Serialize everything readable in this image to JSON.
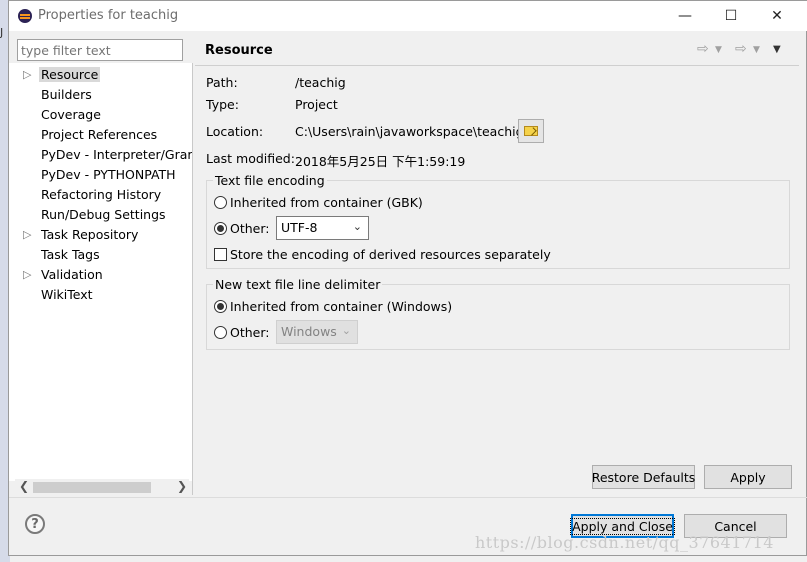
{
  "background": {
    "left_char": "J"
  },
  "window": {
    "title": "Properties for teachig",
    "controls": {
      "minimize": "—",
      "maximize": "☐",
      "close": "✕"
    }
  },
  "filter": {
    "placeholder": "type filter text"
  },
  "tree": {
    "items": [
      {
        "label": "Resource",
        "expandable": true,
        "selected": true
      },
      {
        "label": "Builders",
        "expandable": false
      },
      {
        "label": "Coverage",
        "expandable": false
      },
      {
        "label": "Project References",
        "expandable": false
      },
      {
        "label": "PyDev - Interpreter/Grar",
        "expandable": false
      },
      {
        "label": "PyDev - PYTHONPATH",
        "expandable": false
      },
      {
        "label": "Refactoring History",
        "expandable": false
      },
      {
        "label": "Run/Debug Settings",
        "expandable": false
      },
      {
        "label": "Task Repository",
        "expandable": true
      },
      {
        "label": "Task Tags",
        "expandable": false
      },
      {
        "label": "Validation",
        "expandable": true
      },
      {
        "label": "WikiText",
        "expandable": false
      }
    ]
  },
  "page": {
    "title": "Resource",
    "properties": {
      "path_label": "Path:",
      "path_value": "/teachig",
      "type_label": "Type:",
      "type_value": "Project",
      "location_label": "Location:",
      "location_value": "C:\\Users\\rain\\javaworkspace\\teachig",
      "modified_label": "Last modified:",
      "modified_value": "2018年5月25日 下午1:59:19"
    },
    "encoding": {
      "group_title": "Text file encoding",
      "inherited_label": "Inherited from container (GBK)",
      "other_label": "Other:",
      "other_value": "UTF-8",
      "selected": "other",
      "store_separately_label": "Store the encoding of derived resources separately",
      "store_separately_checked": false
    },
    "delimiter": {
      "group_title": "New text file line delimiter",
      "inherited_label": "Inherited from container (Windows)",
      "other_label": "Other:",
      "other_value": "Windows",
      "selected": "inherited"
    },
    "restore_defaults_label": "Restore Defaults",
    "apply_label": "Apply"
  },
  "footer": {
    "help_label": "?",
    "apply_close_label": "Apply and Close",
    "cancel_label": "Cancel"
  },
  "watermark": "https://blog.csdn.net/qq_37641714"
}
